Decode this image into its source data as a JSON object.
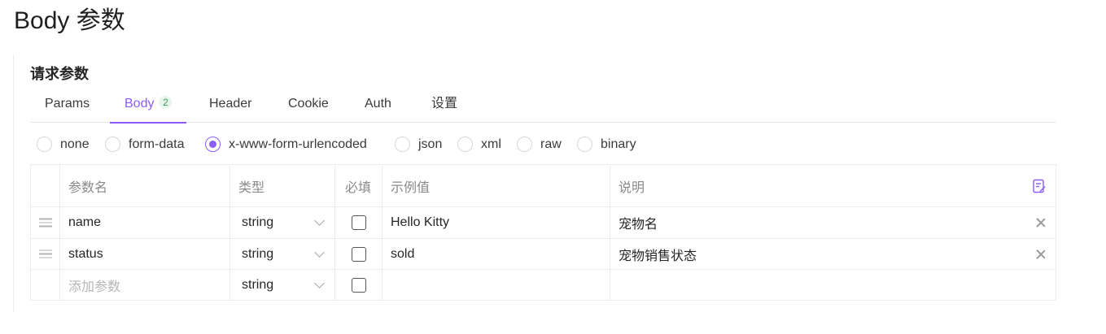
{
  "page": {
    "title": "Body 参数"
  },
  "section": {
    "title": "请求参数"
  },
  "tabs": [
    {
      "label": "Params"
    },
    {
      "label": "Body",
      "badge": "2"
    },
    {
      "label": "Header"
    },
    {
      "label": "Cookie"
    },
    {
      "label": "Auth"
    },
    {
      "label": "设置"
    }
  ],
  "active_tab": "Body",
  "body_types": [
    {
      "label": "none"
    },
    {
      "label": "form-data"
    },
    {
      "label": "x-www-form-urlencoded"
    },
    {
      "label": "json"
    },
    {
      "label": "xml"
    },
    {
      "label": "raw"
    },
    {
      "label": "binary"
    }
  ],
  "selected_body_type": "x-www-form-urlencoded",
  "table": {
    "headers": {
      "name": "参数名",
      "type": "类型",
      "required": "必填",
      "example": "示例值",
      "description": "说明"
    },
    "rows": [
      {
        "name": "name",
        "type": "string",
        "required": false,
        "example": "Hello Kitty",
        "description": "宠物名"
      },
      {
        "name": "status",
        "type": "string",
        "required": false,
        "example": "sold",
        "description": "宠物销售状态"
      }
    ],
    "new_row": {
      "name_placeholder": "添加参数",
      "type": "string",
      "required": false
    }
  },
  "colors": {
    "accent": "#8b5cf6",
    "badge_bg": "#e8f5ec",
    "badge_text": "#3d9a5c"
  }
}
